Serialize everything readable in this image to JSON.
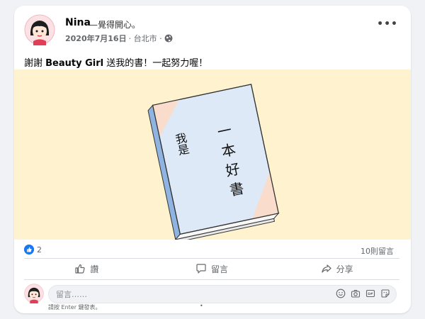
{
  "post": {
    "author": "Nina",
    "feeling": "—覺得開心。",
    "date": "2020年7月16日",
    "location": "· 台北市 ·",
    "more": "•••",
    "text_before": "謝謝 ",
    "text_name": "Beauty Girl",
    "text_after": " 送我的書！一起努力喔！"
  },
  "book": {
    "left_text": "我是",
    "right_text": "一本好書"
  },
  "stats": {
    "likes": "2",
    "comments": "10則留言"
  },
  "actions": {
    "like": "讚",
    "comment": "留言",
    "share": "分享"
  },
  "comment_box": {
    "placeholder": "留言……",
    "hint": "請按 Enter 鍵發表。",
    "hint_dot": "•"
  },
  "colors": {
    "accent": "#1877f2",
    "photo_bg": "#fff2cf",
    "book_cover": "#dde9f7",
    "book_corner": "#f9dccb"
  }
}
